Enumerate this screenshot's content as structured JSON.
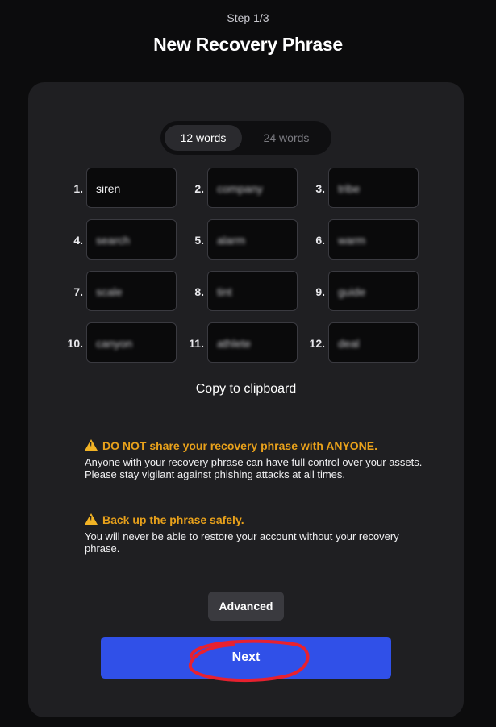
{
  "header": {
    "step": "Step 1/3",
    "title": "New Recovery Phrase"
  },
  "toggle": {
    "options": [
      "12 words",
      "24 words"
    ],
    "selected": "12 words"
  },
  "words": [
    {
      "n": "1.",
      "word": "siren",
      "blurred": false
    },
    {
      "n": "2.",
      "word": "company",
      "blurred": true
    },
    {
      "n": "3.",
      "word": "tribe",
      "blurred": true
    },
    {
      "n": "4.",
      "word": "search",
      "blurred": true
    },
    {
      "n": "5.",
      "word": "alarm",
      "blurred": true
    },
    {
      "n": "6.",
      "word": "warm",
      "blurred": true
    },
    {
      "n": "7.",
      "word": "scale",
      "blurred": true
    },
    {
      "n": "8.",
      "word": "tint",
      "blurred": true
    },
    {
      "n": "9.",
      "word": "guide",
      "blurred": true
    },
    {
      "n": "10.",
      "word": "canyon",
      "blurred": true
    },
    {
      "n": "11.",
      "word": "athlete",
      "blurred": true
    },
    {
      "n": "12.",
      "word": "deal",
      "blurred": true
    }
  ],
  "copy_label": "Copy to clipboard",
  "warnings": [
    {
      "heading": "DO NOT share your recovery phrase with ANYONE.",
      "body": "Anyone with your recovery phrase can have full control over your assets. Please stay vigilant against phishing attacks at all times."
    },
    {
      "heading": "Back up the phrase safely.",
      "body": "You will never be able to restore your account without your recovery phrase."
    }
  ],
  "buttons": {
    "advanced": "Advanced",
    "next": "Next"
  },
  "colors": {
    "accent": "#3050e8",
    "warning": "#e8a11b",
    "annotation": "#e8212f"
  }
}
